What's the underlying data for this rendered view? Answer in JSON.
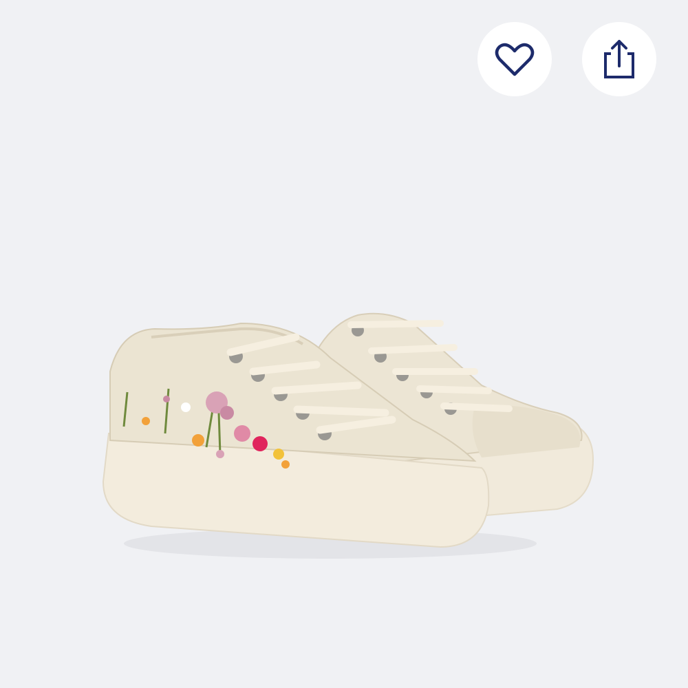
{
  "product": {
    "image_description_icon": "product-photo",
    "colors": {
      "background": "#f0f1f4",
      "icon_stroke": "#1d2b6b",
      "button_bg": "#ffffff",
      "canvas": "#f5f0e4",
      "sole": "#f3ecdc"
    }
  },
  "actions": {
    "wishlist_icon": "heart-icon",
    "share_icon": "share-icon"
  }
}
